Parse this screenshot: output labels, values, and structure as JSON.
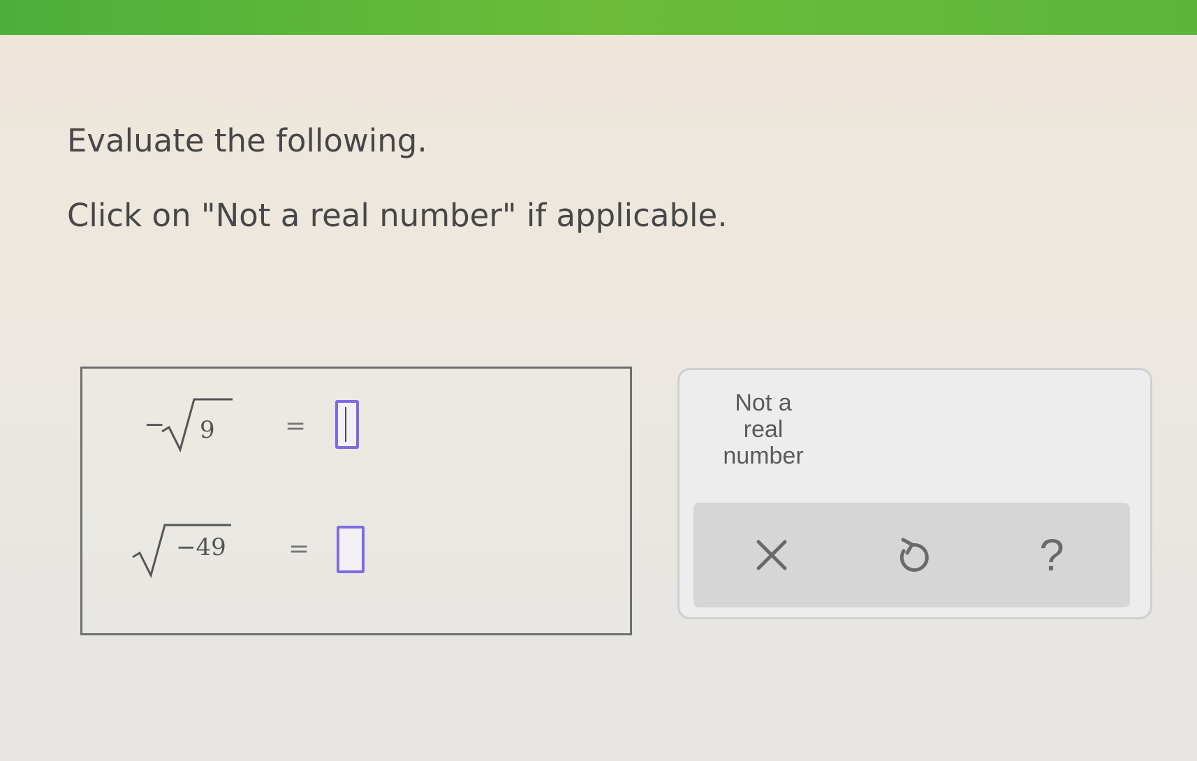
{
  "header": {
    "accent_color": "#5cb53b"
  },
  "instructions": {
    "line1": "Evaluate the following.",
    "line2": "Click on \"Not a real number\" if applicable."
  },
  "problems": [
    {
      "negative_sign": "−",
      "radicand": "9",
      "equals": "=",
      "answer": ""
    },
    {
      "negative_sign": "",
      "radicand": "−49",
      "equals": "=",
      "answer": ""
    }
  ],
  "keypad": {
    "not_real_line1": "Not a",
    "not_real_line2": "real",
    "not_real_line3": "number",
    "clear_icon": "x-icon",
    "undo_icon": "undo-icon",
    "help_label": "?",
    "help_icon": "question-icon"
  },
  "colors": {
    "answer_border": "#7f6be0",
    "keypad_bar": "#d6d6d6"
  }
}
